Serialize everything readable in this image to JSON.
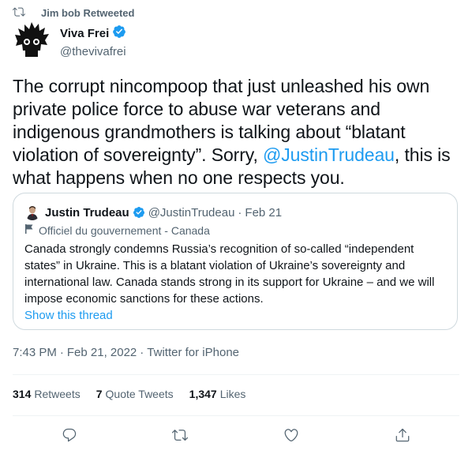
{
  "retweet": {
    "label": "Jim bob Retweeted",
    "icon": "retweet-icon"
  },
  "author": {
    "name": "Viva Frei",
    "handle": "@thevivafrei",
    "verified": true
  },
  "tweet": {
    "text_before": "The corrupt nincompoop that just unleashed his own private police force to abuse war veterans and indigenous grandmothers is talking about “blatant violation of sovereignty”.  Sorry, ",
    "mention": "@JustinTrudeau",
    "text_after": ", this is what happens when no one respects you."
  },
  "quote": {
    "name": "Justin Trudeau",
    "handle": "@JustinTrudeau",
    "dot": "·",
    "date": "Feb 21",
    "label": "Officiel du gouvernement - Canada",
    "text": "Canada strongly condemns Russia’s recognition of so-called “independent states” in Ukraine. This is a blatant violation of Ukraine’s sovereignty and international law. Canada stands strong in its support for Ukraine – and we will impose economic sanctions for these actions.",
    "show_thread": "Show this thread"
  },
  "meta": {
    "time": "7:43 PM",
    "sep": "·",
    "date": "Feb 21, 2022",
    "source": "Twitter for iPhone"
  },
  "stats": {
    "retweets": {
      "count": "314",
      "label": "Retweets"
    },
    "quotes": {
      "count": "7",
      "label": "Quote Tweets"
    },
    "likes": {
      "count": "1,347",
      "label": "Likes"
    }
  },
  "actions": [
    "reply-icon",
    "retweet-icon",
    "like-icon",
    "share-icon"
  ],
  "colors": {
    "accent": "#1d9bf0",
    "secondary_text": "#536471",
    "border": "#cfd9de"
  }
}
